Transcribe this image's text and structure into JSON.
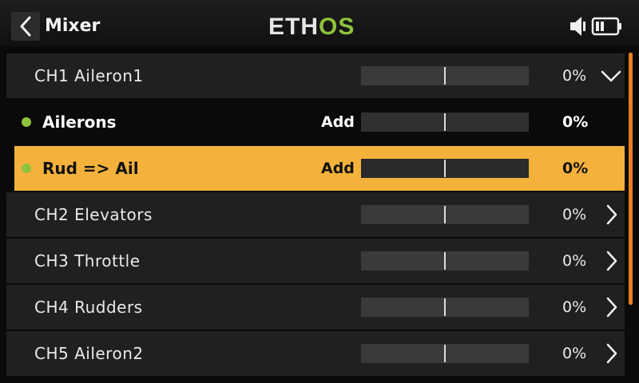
{
  "header": {
    "title": "Mixer",
    "logo_primary": "ETH",
    "logo_accent": "OS",
    "icons": [
      "back-arrow-icon",
      "speaker-icon",
      "battery-icon"
    ]
  },
  "mixer": {
    "rows": [
      {
        "type": "channel",
        "label": "CH1 Aileron1",
        "value": "0%",
        "bar_level": 0.5,
        "chevron": "chevron-down-icon"
      },
      {
        "type": "mix",
        "label": "Ailerons",
        "mode": "Add",
        "value": "0%",
        "bar_level": 0.5
      },
      {
        "type": "mix",
        "label": "Rud => Ail",
        "mode": "Add",
        "value": "0%",
        "bar_level": 0.5,
        "selected": true
      },
      {
        "type": "channel",
        "label": "CH2 Elevators",
        "value": "0%",
        "bar_level": 0.5,
        "chevron": "chevron-right-icon"
      },
      {
        "type": "channel",
        "label": "CH3 Throttle",
        "value": "0%",
        "bar_level": 0.5,
        "chevron": "chevron-right-icon"
      },
      {
        "type": "channel",
        "label": "CH4 Rudders",
        "value": "0%",
        "bar_level": 0.5,
        "chevron": "chevron-right-icon"
      },
      {
        "type": "channel",
        "label": "CH5 Aileron2",
        "value": "0%",
        "bar_level": 0.5,
        "chevron": "chevron-right-icon"
      }
    ]
  },
  "colors": {
    "accent_green": "#8ec33d",
    "selection": "#f4b23c",
    "scrollbar": "#e87e1c"
  }
}
